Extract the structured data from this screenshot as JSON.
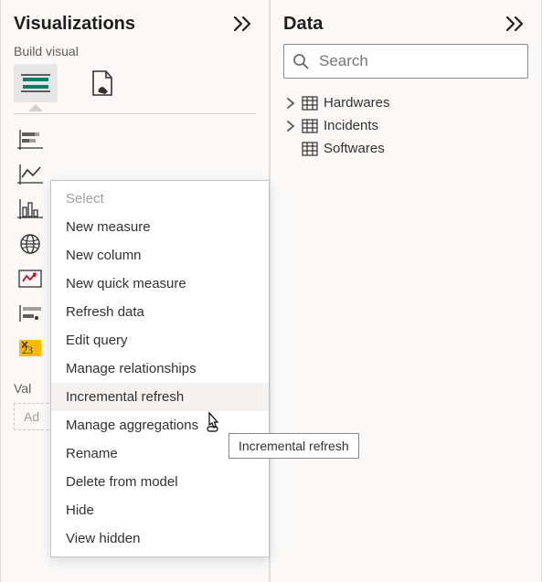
{
  "viz_pane": {
    "title": "Visualizations",
    "subtitle": "Build visual",
    "values_label": "Val",
    "add_fields_label": "Ad"
  },
  "data_pane": {
    "title": "Data",
    "search_placeholder": "Search",
    "tables": [
      {
        "name": "Hardwares"
      },
      {
        "name": "Incidents"
      },
      {
        "name": "Softwares"
      }
    ]
  },
  "context_menu": {
    "items": [
      {
        "label": "Select",
        "disabled": true
      },
      {
        "label": "New measure"
      },
      {
        "label": "New column"
      },
      {
        "label": "New quick measure"
      },
      {
        "label": "Refresh data"
      },
      {
        "label": "Edit query"
      },
      {
        "label": "Manage relationships"
      },
      {
        "label": "Incremental refresh",
        "hovered": true
      },
      {
        "label": "Manage aggregations"
      },
      {
        "label": "Rename"
      },
      {
        "label": "Delete from model"
      },
      {
        "label": "Hide"
      },
      {
        "label": "View hidden"
      }
    ]
  },
  "tooltip_text": "Incremental refresh"
}
